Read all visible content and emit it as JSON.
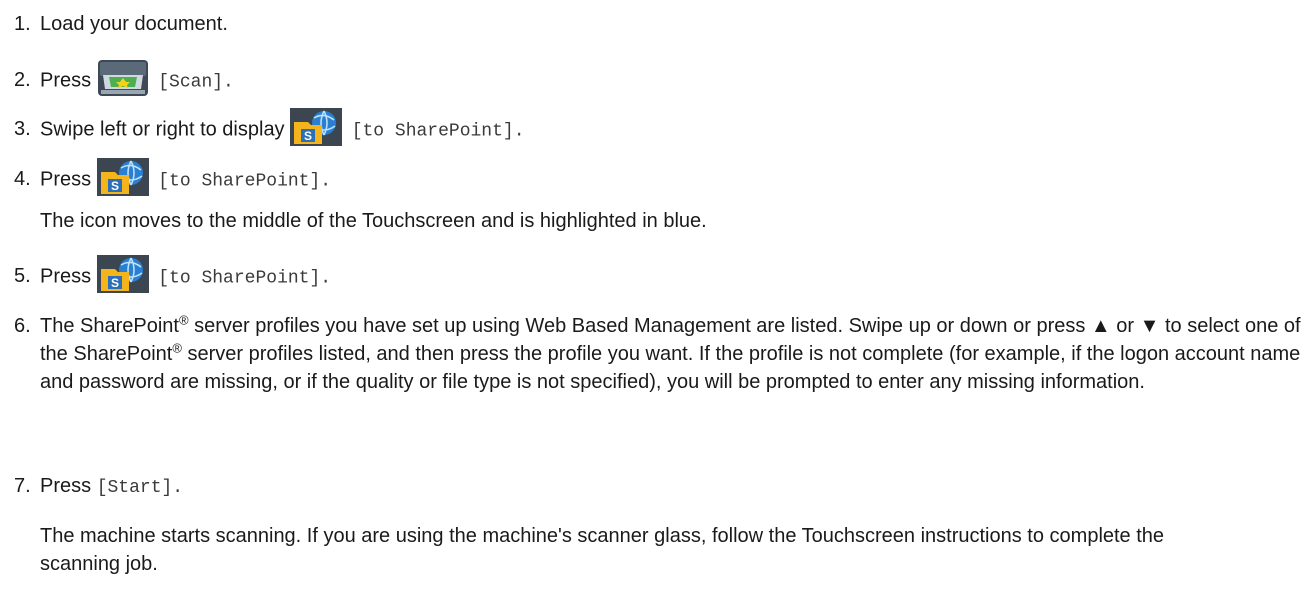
{
  "steps": [
    {
      "num": "1.",
      "text": "Load your document."
    },
    {
      "num": "2.",
      "text": "Press",
      "label": "[Scan].",
      "icon": "scan-icon"
    },
    {
      "num": "3.",
      "text": "Swipe left or right to display",
      "label": "[to SharePoint].",
      "icon": "sharepoint-icon"
    },
    {
      "num": "4.",
      "text": "Press",
      "label": "[to SharePoint].",
      "icon": "sharepoint-icon",
      "note": "The icon moves to the middle of the Touchscreen and is highlighted in blue."
    },
    {
      "num": "5.",
      "text": "Press",
      "label": "[to SharePoint].",
      "icon": "sharepoint-icon"
    },
    {
      "num": "6.",
      "t1": "The SharePoint",
      "reg": "®",
      "t2": " server profiles you have set up using Web Based Management are listed. Swipe up or down or press ▲ or ▼ to select one of the SharePoint",
      "t3": " server profiles listed, and then press the profile you want. If the profile is not complete (for example, if the logon account name and password are missing, or if the quality or file type is not specified), you will be prompted to enter any missing information."
    },
    {
      "num": "7.",
      "text": "Press",
      "label": "[Start].",
      "note": "The machine starts scanning. If you are using the machine's scanner glass, follow the Touchscreen instructions to complete the scanning job."
    }
  ],
  "colors": {
    "text": "#1a1a1a",
    "mono": "#3a3a3a",
    "folder": "#f3b51b",
    "globe": "#2a7fd0",
    "scan_bg": "#3d4a56"
  }
}
